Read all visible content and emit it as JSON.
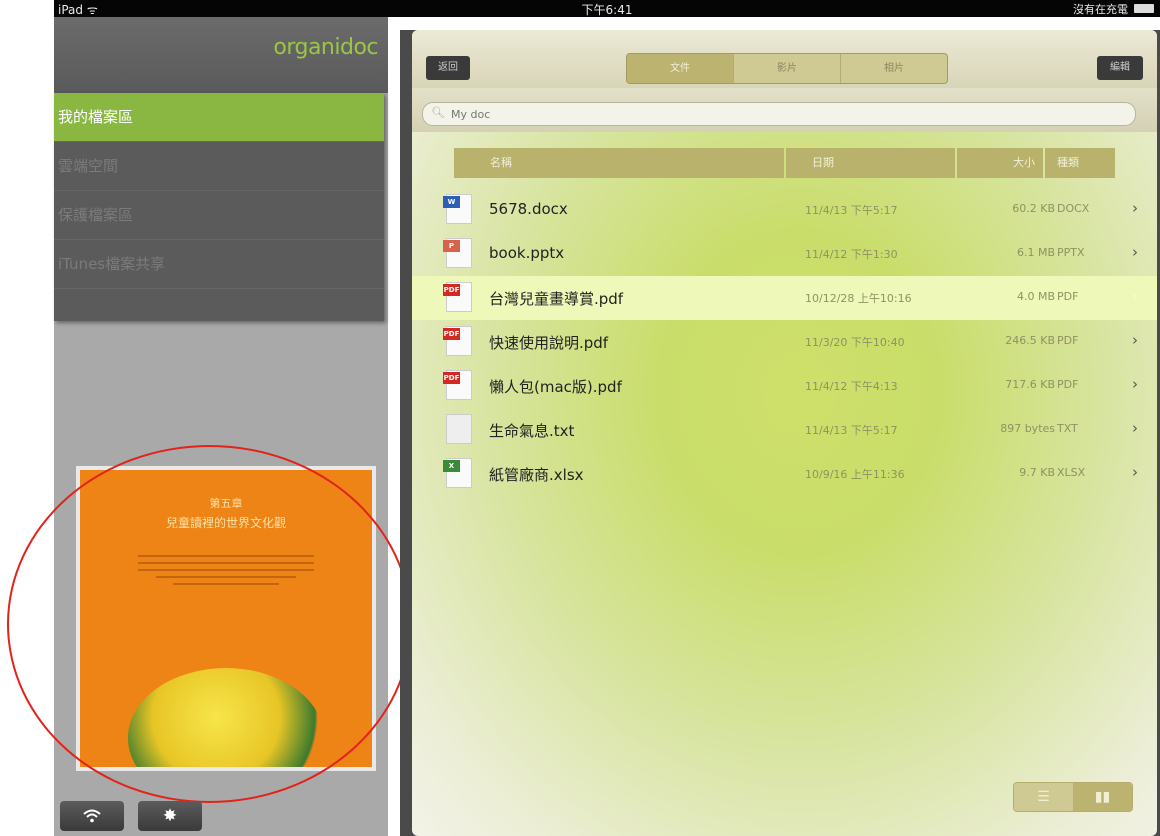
{
  "status_bar": {
    "device": "iPad ᯤ",
    "time": "下午6:41",
    "battery_text": "沒有在充電"
  },
  "sidebar": {
    "logo": "organidoc",
    "items": [
      {
        "label": "我的檔案區",
        "active": true
      },
      {
        "label": "雲端空間",
        "active": false
      },
      {
        "label": "保護檔案區",
        "active": false
      },
      {
        "label": "iTunes檔案共享",
        "active": false
      }
    ],
    "preview": {
      "chapter": "第五章",
      "subtitle": "兒童讀裡的世界文化觀"
    },
    "wifi_icon": "wifi-icon",
    "settings_icon": "gear-icon"
  },
  "toolbar": {
    "back_label": "返回",
    "segments": [
      "文件",
      "影片",
      "相片"
    ],
    "active_segment": 0,
    "edit_label": "編輯"
  },
  "search": {
    "placeholder": "My doc"
  },
  "table": {
    "columns": [
      "名稱",
      "日期",
      "大小",
      "種類"
    ],
    "rows": [
      {
        "name": "5678.docx",
        "date": "11/4/13 下午5:17",
        "size": "60.2 KB",
        "type": "DOCX",
        "icon": "docx-file-icon"
      },
      {
        "name": "book.pptx",
        "date": "11/4/12 下午1:30",
        "size": "6.1 MB",
        "type": "PPTX",
        "icon": "pptx-file-icon"
      },
      {
        "name": "台灣兒童畫導賞.pdf",
        "date": "10/12/28 上午10:16",
        "size": "4.0 MB",
        "type": "PDF",
        "icon": "pdf-file-icon",
        "selected": true
      },
      {
        "name": "快速使用說明.pdf",
        "date": "11/3/20 下午10:40",
        "size": "246.5 KB",
        "type": "PDF",
        "icon": "pdf-file-icon"
      },
      {
        "name": "懶人包(mac版).pdf",
        "date": "11/4/12 下午4:13",
        "size": "717.6 KB",
        "type": "PDF",
        "icon": "pdf-file-icon"
      },
      {
        "name": "生命氣息.txt",
        "date": "11/4/13 下午5:17",
        "size": "897 bytes",
        "type": "TXT",
        "icon": "txt-file-icon"
      },
      {
        "name": "紙管廠商.xlsx",
        "date": "10/9/16 上午11:36",
        "size": "9.7 KB",
        "type": "XLSX",
        "icon": "xlsx-file-icon"
      }
    ]
  },
  "view_toggle": {
    "list_icon": "list-view-icon",
    "grid_icon": "grid-view-icon",
    "active": "grid"
  },
  "colors": {
    "accent_green": "#8ab741",
    "toolbar_olive": "#bbb36f",
    "pdf_red": "#d22a23"
  }
}
